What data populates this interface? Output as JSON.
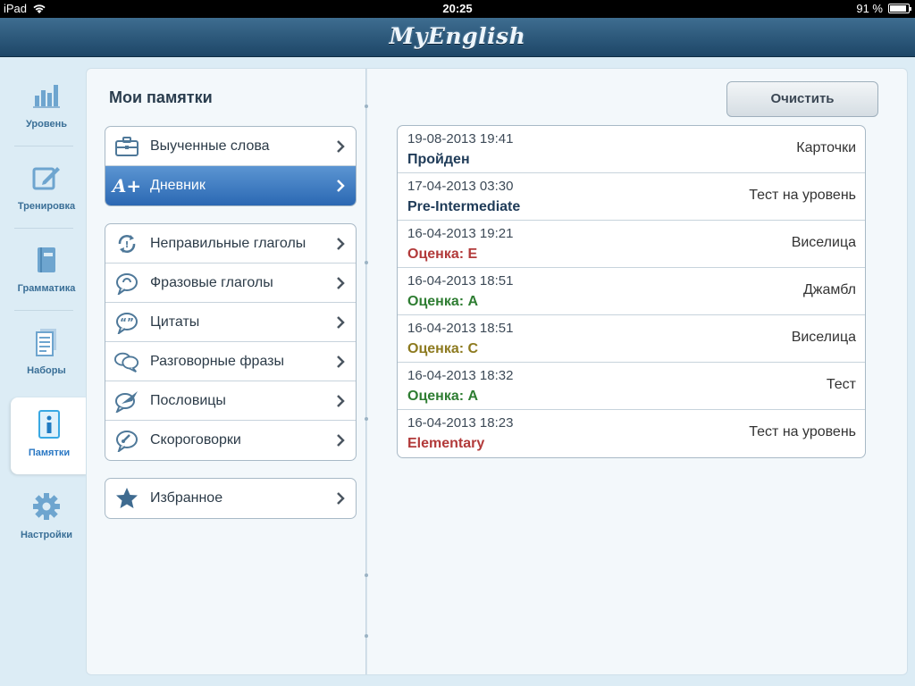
{
  "status_bar": {
    "device": "iPad",
    "time": "20:25",
    "battery": "91 %",
    "battery_level": 0.91
  },
  "app": {
    "title": "MyEnglish"
  },
  "tabs": [
    {
      "label": "Уровень",
      "icon": "bar-chart-icon",
      "active": false
    },
    {
      "label": "Тренировка",
      "icon": "pencil-edit-icon",
      "active": false
    },
    {
      "label": "Грамматика",
      "icon": "grammar-book-icon",
      "active": false
    },
    {
      "label": "Наборы",
      "icon": "document-stack-icon",
      "active": false
    },
    {
      "label": "Памятки",
      "icon": "info-icon",
      "active": true
    },
    {
      "label": "Настройки",
      "icon": "gear-icon",
      "active": false
    }
  ],
  "sidebar": {
    "title": "Мои памятки",
    "group1": [
      {
        "label": "Выученные слова",
        "icon": "briefcase-icon"
      },
      {
        "label": "Дневник",
        "icon": "grade-a-plus-icon",
        "selected": true
      }
    ],
    "group2": [
      {
        "label": "Неправильные глаголы",
        "icon": "refresh-arrows-icon"
      },
      {
        "label": "Фразовые глаголы",
        "icon": "speech-bubble-cycle-icon"
      },
      {
        "label": "Цитаты",
        "icon": "quote-bubble-icon"
      },
      {
        "label": "Разговорные фразы",
        "icon": "chat-bubbles-icon"
      },
      {
        "label": "Пословицы",
        "icon": "quill-bubble-icon"
      },
      {
        "label": "Скороговорки",
        "icon": "speed-bubble-icon"
      }
    ],
    "group3": [
      {
        "label": "Избранное",
        "icon": "star-icon"
      }
    ]
  },
  "toolbar": {
    "clear_label": "Очистить"
  },
  "diary": [
    {
      "date": "19-08-2013 19:41",
      "result": "Пройден",
      "result_color": "#1f3b58",
      "activity": "Карточки"
    },
    {
      "date": "17-04-2013 03:30",
      "result": "Pre-Intermediate",
      "result_color": "#1f3b58",
      "activity": "Тест на уровень"
    },
    {
      "date": "16-04-2013 19:21",
      "result": "Оценка: E",
      "result_color": "#b23a3a",
      "activity": "Виселица"
    },
    {
      "date": "16-04-2013 18:51",
      "result": "Оценка: A",
      "result_color": "#2e7d32",
      "activity": "Джамбл"
    },
    {
      "date": "16-04-2013 18:51",
      "result": "Оценка: C",
      "result_color": "#8d7a1f",
      "activity": "Виселица"
    },
    {
      "date": "16-04-2013 18:32",
      "result": "Оценка: A",
      "result_color": "#2e7d32",
      "activity": "Тест"
    },
    {
      "date": "16-04-2013 18:23",
      "result": "Elementary",
      "result_color": "#b23a3a",
      "activity": "Тест на уровень"
    }
  ]
}
